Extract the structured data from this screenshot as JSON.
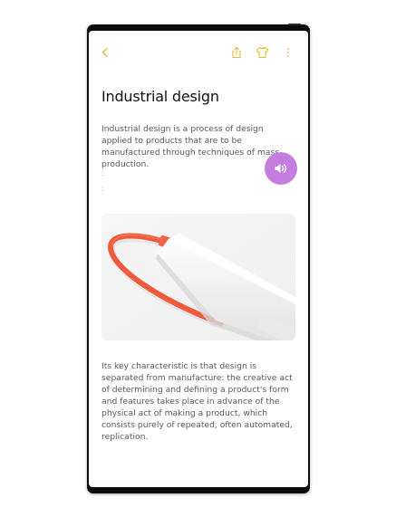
{
  "toolbar": {
    "icons": [
      "back-icon",
      "share-icon",
      "theme-shirt-icon",
      "more-icon"
    ],
    "accent_color": "#e6b93e"
  },
  "note": {
    "title": "Industrial design",
    "paragraph_1": "Industrial design is a process of design applied to products that are to be manufactured through techniques of mass production.",
    "paragraph_2": "Its key characteristic is that design is separated from manufacture: the creative act of determining and defining a product's form and features takes place in advance of the physical act of making a product, which consists purely of repeated, often automated, replication."
  },
  "audio_button": {
    "icon": "speaker-icon",
    "color": "#c47ee0"
  },
  "image": {
    "subject": "usb-cable-photo",
    "cable_color": "#ef5a3c"
  }
}
